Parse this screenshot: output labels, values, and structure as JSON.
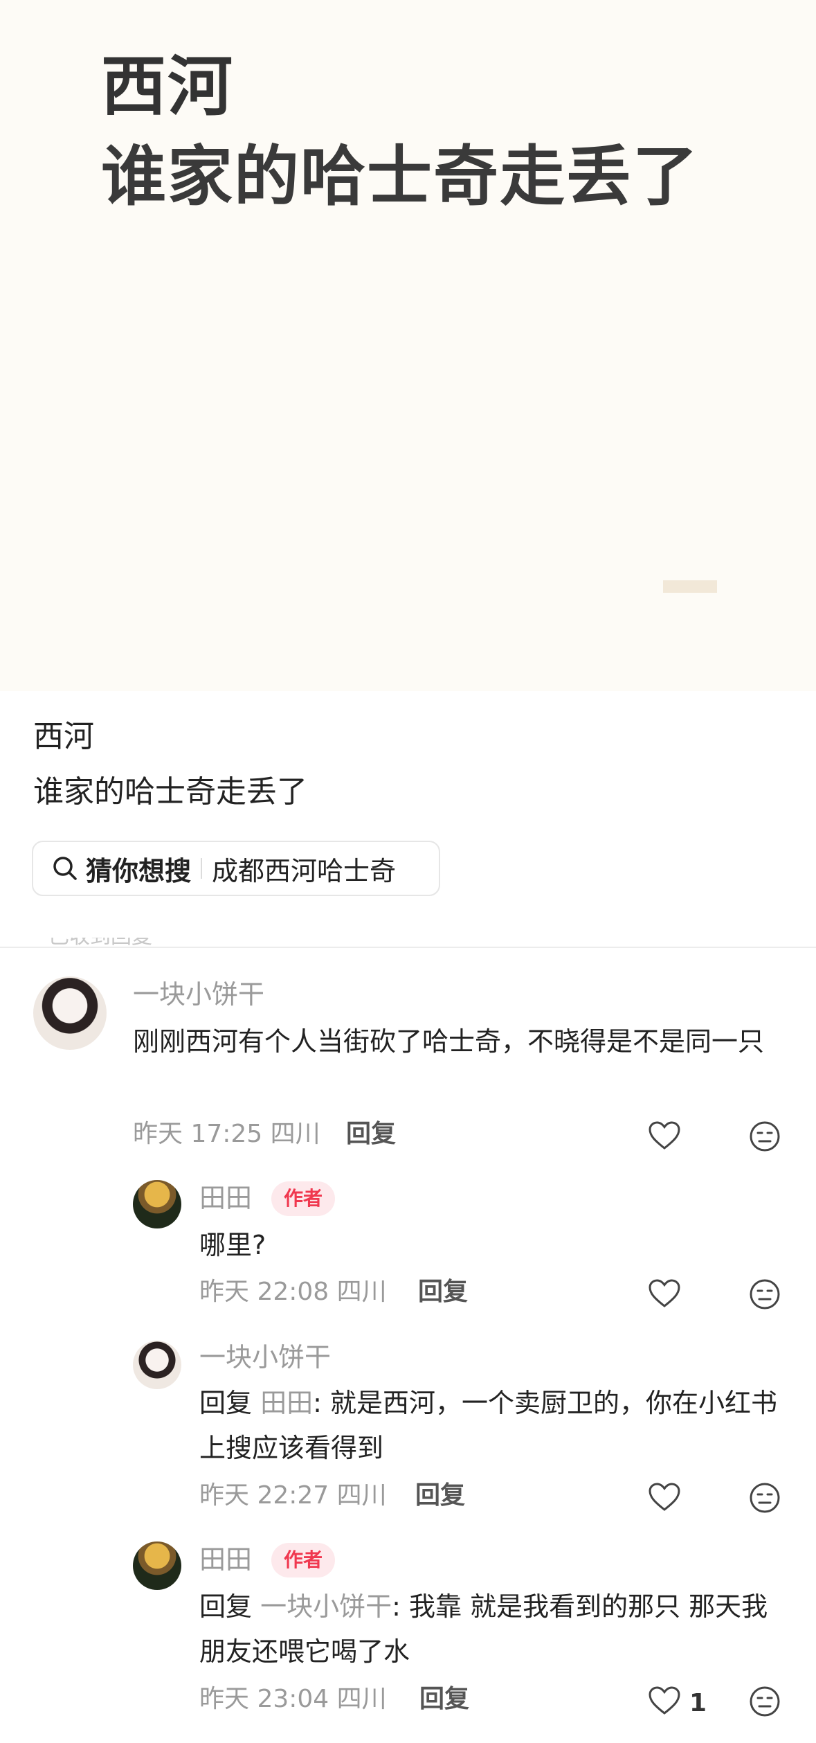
{
  "cover": {
    "title_line1": "西河",
    "title_line2": "谁家的哈士奇走丢了"
  },
  "post": {
    "title": "西河",
    "body": "谁家的哈士奇走丢了"
  },
  "search_tag": {
    "label": "猜你想搜",
    "keyword": "成都西河哈士奇"
  },
  "section_hint": "已收到回复",
  "comments": [
    {
      "author": "一块小饼干",
      "text": "刚刚西河有个人当街砍了哈士奇，不晓得是不是同一只",
      "time": "昨天 17:25 四川",
      "reply_label": "回复"
    },
    {
      "author": "田田",
      "badge": "作者",
      "text": "哪里?",
      "time": "昨天 22:08 四川",
      "reply_label": "回复"
    },
    {
      "author": "一块小饼干",
      "reply_prefix": "回复",
      "mention": "田田",
      "text": ": 就是西河，一个卖厨卫的，你在小红书上搜应该看得到",
      "time": "昨天 22:27 四川",
      "reply_label": "回复"
    },
    {
      "author": "田田",
      "badge": "作者",
      "reply_prefix": "回复",
      "mention": "一块小饼干",
      "text": ": 我靠 就是我看到的那只 那天我朋友还喂它喝了水",
      "time": "昨天 23:04 四川",
      "reply_label": "回复",
      "likes": "1"
    }
  ],
  "icons": {
    "search": "search-icon",
    "like": "heart-icon",
    "dislike": "meh-face-icon"
  },
  "colors": {
    "highlight": "#b8f07a",
    "author_badge": "#f0384f",
    "cover_bg": "#fdfbf6"
  }
}
